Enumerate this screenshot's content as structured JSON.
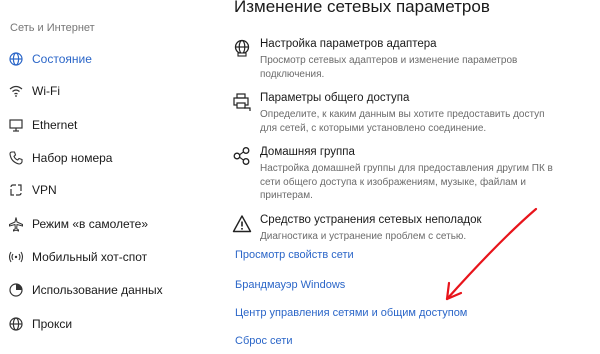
{
  "sidebar": {
    "section_title": "Сеть и Интернет",
    "items": [
      {
        "label": "Состояние",
        "icon": "globe-icon",
        "active": true
      },
      {
        "label": "Wi-Fi",
        "icon": "wifi-icon",
        "active": false
      },
      {
        "label": "Ethernet",
        "icon": "ethernet-icon",
        "active": false
      },
      {
        "label": "Набор номера",
        "icon": "phone-icon",
        "active": false
      },
      {
        "label": "VPN",
        "icon": "vpn-icon",
        "active": false
      },
      {
        "label": "Режим «в самолете»",
        "icon": "airplane-icon",
        "active": false
      },
      {
        "label": "Мобильный хот-спот",
        "icon": "hotspot-icon",
        "active": false
      },
      {
        "label": "Использование данных",
        "icon": "data-usage-icon",
        "active": false
      },
      {
        "label": "Прокси",
        "icon": "globe-proxy-icon",
        "active": false
      }
    ]
  },
  "main": {
    "title": "Изменение сетевых параметров",
    "options": [
      {
        "title": "Настройка параметров адаптера",
        "description": "Просмотр сетевых адаптеров и изменение параметров подключения.",
        "icon": "adapter-globe-icon"
      },
      {
        "title": "Параметры общего доступа",
        "description": "Определите, к каким данным вы хотите предоставить доступ для сетей, с которыми установлено соединение.",
        "icon": "printer-share-icon"
      },
      {
        "title": "Домашняя группа",
        "description": "Настройка домашней группы для предоставления другим ПК в сети общего доступа к изображениям, музыке, файлам и принтерам.",
        "icon": "homegroup-icon"
      },
      {
        "title": "Средство устранения сетевых неполадок",
        "description": "Диагностика и устранение проблем с сетью.",
        "icon": "warning-icon"
      }
    ],
    "links": [
      "Просмотр свойств сети",
      "Брандмауэр Windows",
      "Центр управления сетями и общим доступом",
      "Сброс сети"
    ]
  },
  "colors": {
    "accent": "#2b66c8",
    "annotation_arrow": "#e8141b",
    "description_text": "#6b6b6b"
  }
}
